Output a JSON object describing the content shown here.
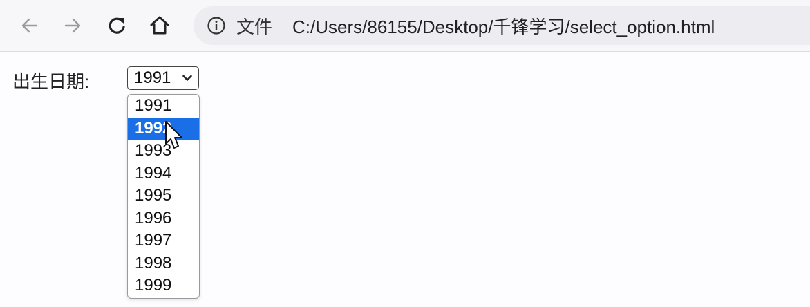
{
  "browser": {
    "back_icon": "arrow-left-icon",
    "forward_icon": "arrow-right-icon",
    "reload_icon": "reload-icon",
    "home_icon": "home-icon",
    "info_icon": "info-icon",
    "scheme_label": "文件",
    "url": "C:/Users/86155/Desktop/千锋学习/select_option.html"
  },
  "form": {
    "label": "出生日期:",
    "select": {
      "value": "1991",
      "options": [
        "1991",
        "1992",
        "1993",
        "1994",
        "1995",
        "1996",
        "1997",
        "1998",
        "1999"
      ],
      "highlighted": "1992"
    }
  },
  "colors": {
    "highlight": "#1a6fe6",
    "toolbar": "#f7f7fa",
    "address_bar": "#ececf1"
  }
}
